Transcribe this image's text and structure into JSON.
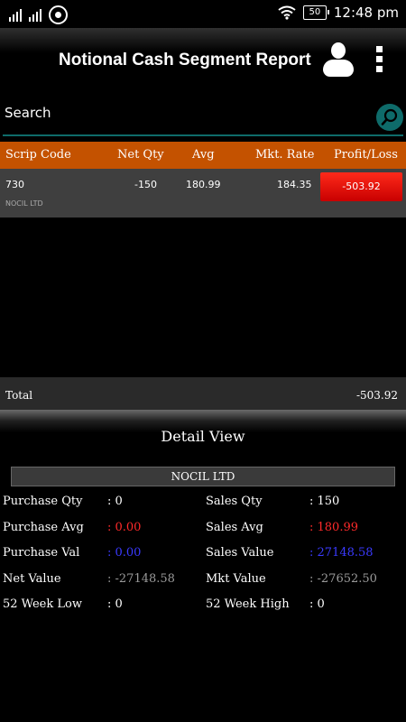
{
  "status_bar": {
    "signal1_label": "",
    "signal2_label": "",
    "battery": "50",
    "time": "12:48 pm"
  },
  "app_bar": {
    "title": "Notional Cash Segment Report",
    "profile_icon": "person-icon",
    "menu_icon": "more-vert-icon"
  },
  "search": {
    "placeholder": "Search",
    "icon": "search-icon"
  },
  "table": {
    "columns": [
      "Scrip Code",
      "Net Qty",
      "Avg",
      "Mkt. Rate",
      "Profit/Loss"
    ],
    "rows": [
      {
        "scrip_code": "730",
        "scrip_name": "NOCIL LTD",
        "net_qty": "-150",
        "avg": "180.99",
        "mkt_rate": "184.35",
        "profit_loss": "-503.92"
      }
    ]
  },
  "total": {
    "label": "Total",
    "value": "-503.92"
  },
  "detail": {
    "title": "Detail View",
    "scrip_name": "NOCIL LTD",
    "left": [
      {
        "label": "Purchase Qty",
        "value": ": 0",
        "color": "#ffffff"
      },
      {
        "label": "Purchase Avg",
        "value": ": 0.00",
        "color": "#ff2a2a"
      },
      {
        "label": "Purchase Val",
        "value": ": 0.00",
        "color": "#3a3aff"
      },
      {
        "label": "Net Value",
        "value": ": -27148.58",
        "color": "#9a9a9a"
      },
      {
        "label": "52 Week Low",
        "value": ": 0",
        "color": "#ffffff"
      }
    ],
    "right": [
      {
        "label": "Sales Qty",
        "value": ": 150",
        "color": "#ffffff"
      },
      {
        "label": "Sales Avg",
        "value": ": 180.99",
        "color": "#ff2a2a"
      },
      {
        "label": "Sales Value",
        "value": ": 27148.58",
        "color": "#3a3aff"
      },
      {
        "label": "Mkt Value",
        "value": ": -27652.50",
        "color": "#9a9a9a"
      },
      {
        "label": "52 Week High",
        "value": ": 0",
        "color": "#ffffff"
      }
    ]
  },
  "colors": {
    "header_orange": "#c45200",
    "accent_teal": "#0e6b6a",
    "loss_red": "#e01010"
  }
}
